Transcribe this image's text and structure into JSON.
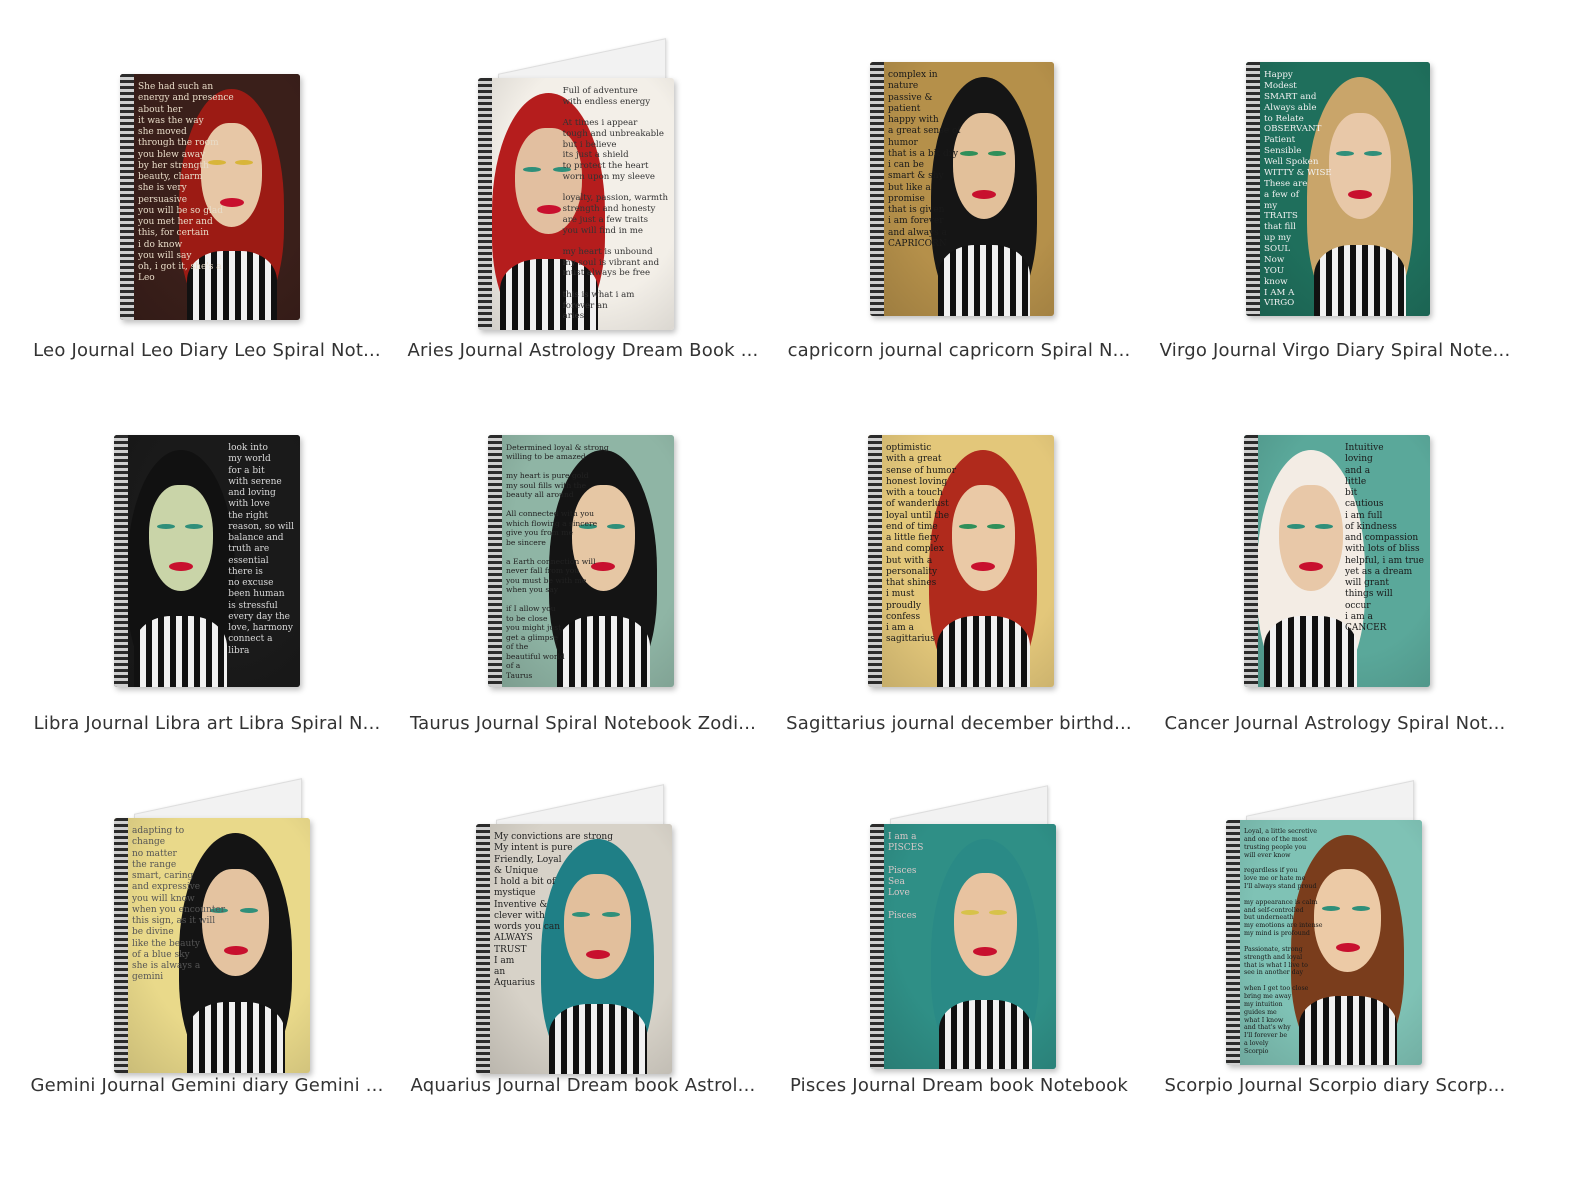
{
  "products": [
    {
      "title": "Leo Journal Leo Diary Leo Spiral Not...",
      "cover_text": "She had such an\nenergy and presence\nabout her\nit was the way\nshe moved\nthrough the room\nyou blew away\nby her strength\nbeauty, charm\nshe is very\npersuasive\nyou will be so glad\nyou met her and\nthis, for certain\ni do know\nyou will say\noh, i got it, she's a\nLeo",
      "bg": "#3a1f1a",
      "hair": "#9c1b14",
      "skin": "#e7c7a6",
      "text_color": "#e8dcc8",
      "eye": "#d8b53a"
    },
    {
      "title": "Aries Journal Astrology Dream Book ...",
      "cover_text": "Full of adventure\nwith endless energy\n\nAt times i appear\ntough and unbreakable\nbut i believe\nits just a shield\nto protect the heart\nworn upon my sleeve\n\nloyalty, passion, warmth\nstrength and honesty\nare just a few traits\nyou will find in me\n\nmy heart is unbound\nmy soul is vibrant and\nmust always be free\n\nthis is what i am\nforever an\naries",
      "bg": "#f3efe8",
      "hair": "#b51d1d",
      "skin": "#e2bfa0",
      "text_color": "#333333",
      "eye": "#2f8f7a"
    },
    {
      "title": "capricorn journal capricorn Spiral N...",
      "cover_text": "complex in\nnature\npassive &\npatient\nhappy with\na great sense of\nhumor\nthat is a bit dry\ni can be\nsmart & shy\nbut like a\npromise\nthat is given\ni am forever\nand always a\nCAPRICORN",
      "bg": "#b5904a",
      "hair": "#151515",
      "skin": "#e2c09a",
      "text_color": "#1a1a1a",
      "eye": "#2f8f5a"
    },
    {
      "title": "Virgo Journal Virgo Diary Spiral Note...",
      "cover_text": "Happy\nModest\nSMART and\nAlways able\nto Relate\nOBSERVANT\nPatient\nSensible\nWell Spoken\nWITTY & WISE\nThese are\na few of\nmy\nTRAITS\nthat fill\nup my\nSOUL\nNow\nYOU\nknow\nI AM A\nVIRGO",
      "bg": "#1f6f5c",
      "hair": "#c9a56a",
      "skin": "#e8c8a8",
      "text_color": "#f1f1f1",
      "eye": "#2f8f7a"
    },
    {
      "title": "Libra Journal Libra art Libra Spiral N...",
      "cover_text": "look into\nmy world\nfor a bit\nwith serene\nand loving\nwith love\nthe right\nreason, so will\nbalance and\ntruth are\nessential\nthere is\nno excuse\nbeen human\nis stressful\nevery day the\nlove, harmony\nconnect a\nlibra",
      "bg": "#1a1a1a",
      "hair": "#111111",
      "skin": "#c9d4a8",
      "text_color": "#d9d9d9",
      "eye": "#2f8f7a"
    },
    {
      "title": "Taurus Journal Spiral Notebook Zodi...",
      "cover_text": "Determined loyal & strong\nwilling to be amazed\n\nmy heart is pure gold\nmy soul fills with the\nbeauty all around\n\nAll connected with you\nwhich flowing a sincere\ngive you from me\nbe sincere\n\na Earth connection will\nnever fall from you\nyou must be with me\nwhen you say\n\nif I allow you\nto be close\nyou might just\nget a glimpse\nof the\nbeautiful world\nof a\nTaurus",
      "bg": "#8fb5a5",
      "hair": "#141414",
      "skin": "#e6c7a4",
      "text_color": "#222222",
      "eye": "#2f8f7a"
    },
    {
      "title": "Sagittarius journal december birthd...",
      "cover_text": "optimistic\nwith a great\nsense of humor\nhonest loving\nwith a touch\nof wanderlust\nloyal until the\nend of time\na little fiery\nand complex\nbut with a\npersonality\nthat shines\ni must\nproudly\nconfess\ni am a\nsagittarius",
      "bg": "#e3c77a",
      "hair": "#b02a1c",
      "skin": "#eac9a6",
      "text_color": "#1a1a1a",
      "eye": "#2f8f5a"
    },
    {
      "title": "Cancer Journal Astrology Spiral Not...",
      "cover_text": "Intuitive\nloving\nand a\nlittle\nbit\ncautious\ni am full\nof kindness\nand compassion\nwith lots of bliss\nhelpful, i am true\nyet as a dream\nwill grant\nthings will\noccur\ni am a\nCANCER",
      "bg": "#5aa89a",
      "hair": "#f3ece4",
      "skin": "#e8c8a8",
      "text_color": "#1a1a1a",
      "eye": "#2f8f7a"
    },
    {
      "title": "Gemini Journal Gemini diary Gemini ...",
      "cover_text": "adapting to\nchange\nno matter\nthe range\nsmart, caring\nand expressive\nyou will know\nwhen you encounter\nthis sign, as it will\nbe divine\nlike the beauty\nof a blue sky\nshe is always a\ngemini",
      "bg": "#e9d98a",
      "hair": "#141414",
      "skin": "#e4c3a0",
      "text_color": "#555555",
      "eye": "#2f8f7a"
    },
    {
      "title": "Aquarius Journal Dream book Astrol...",
      "cover_text": "My convictions are strong\nMy intent is pure\nFriendly, Loyal\n& Unique\nI hold a bit of\nmystique\nInventive &\nclever with\nwords you can\nALWAYS\nTRUST\nI am\nan\nAquarius",
      "bg": "#d7d2c8",
      "hair": "#1f7f86",
      "skin": "#e2bf9c",
      "text_color": "#222222",
      "eye": "#2f8f7a"
    },
    {
      "title": "Pisces Journal Dream book Notebook",
      "cover_text": "I am a\nPISCES\n\nPisces\nSea\nLove\n\nPisces",
      "bg": "#2f8f86",
      "hair": "#2a8a86",
      "skin": "#e8c3a0",
      "text_color": "#d8c8c8",
      "eye": "#d7c24a"
    },
    {
      "title": "Scorpio Journal Scorpio diary Scorp...",
      "cover_text": "Loyal, a little secretive\nand one of the most\ntrusting people you\nwill ever know\n\nregardless if you\nlove me or hate me\nI'll always stand proud\n\nmy appearance is calm\nand self-controlled\nbut underneath\nmy emotions are intense\nmy mind is profound\n\nPassionate, strong\nstrength and loyal\nthat is what I live to\nsee in another day\n\nwhen I get too close\nbring me away\nmy intuition\nguides me\nwhat I know\nand that's why\nI'll forever be\na lovely\nScorpio",
      "bg": "#7fc2b5",
      "hair": "#7a3d1c",
      "skin": "#eccaa6",
      "text_color": "#1a1a1a",
      "eye": "#2f8f7a"
    }
  ]
}
